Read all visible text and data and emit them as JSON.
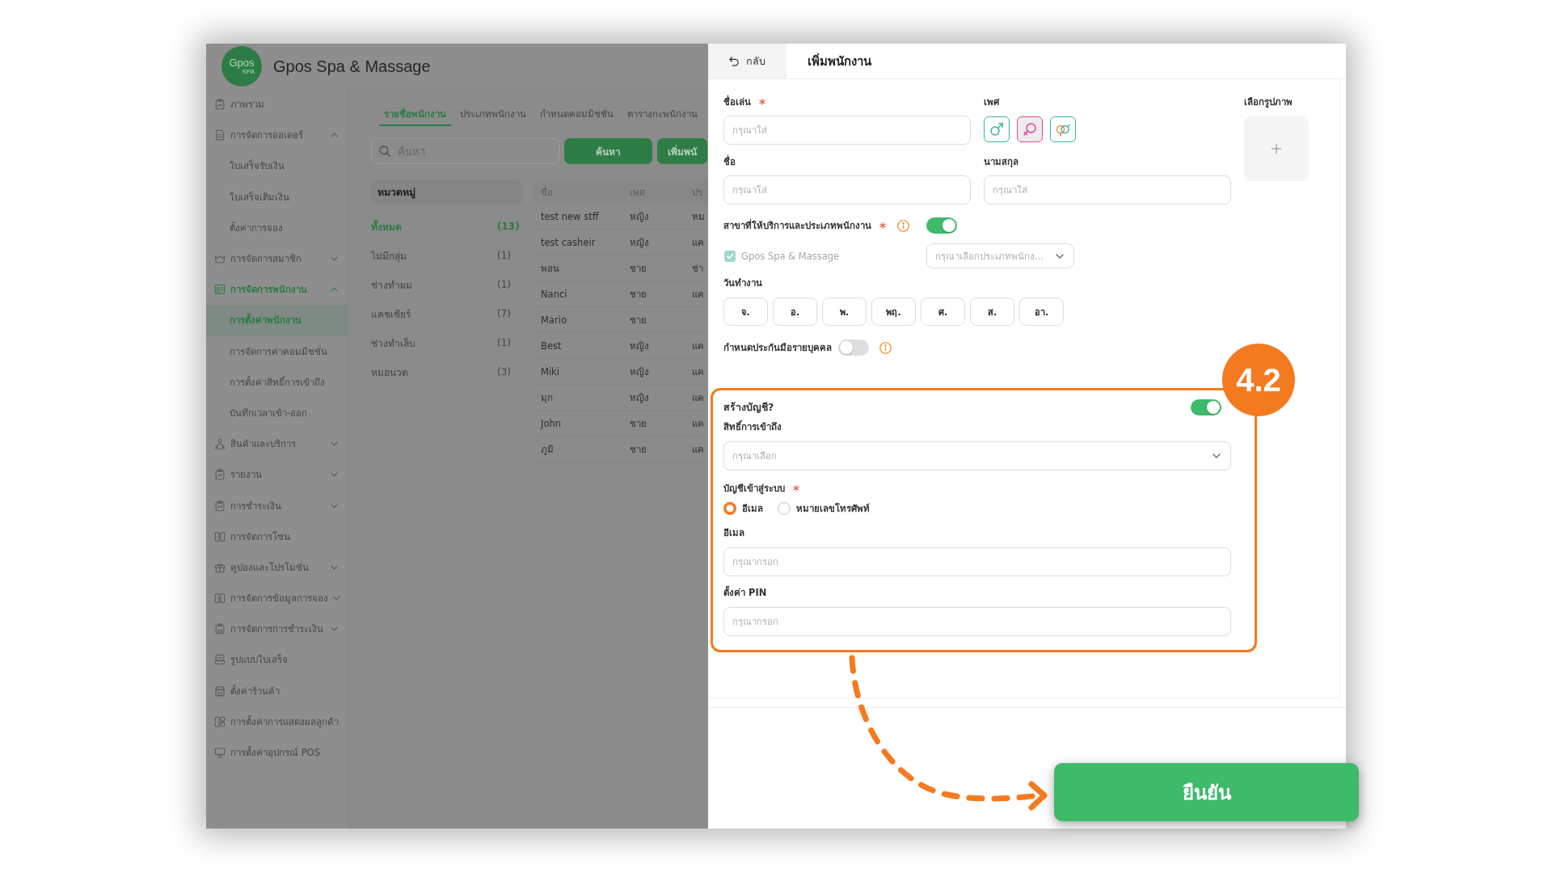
{
  "brand": {
    "logo_text": "Gpos",
    "logo_subtext": "SPA",
    "name": "Gpos Spa & Massage"
  },
  "sidebar": {
    "items": [
      {
        "kind": "link",
        "label": "ภาพรวม",
        "selected": false
      },
      {
        "kind": "group",
        "label": "การจัดการออเดอร์",
        "selected": false,
        "expanded": true,
        "children": [
          {
            "label": "ใบเสร็จรับเงิน",
            "selected": false
          },
          {
            "label": "ใบเสร็จเติมเงิน",
            "selected": false
          },
          {
            "label": "ตั้งค่าการจอง",
            "selected": false
          }
        ]
      },
      {
        "kind": "group",
        "label": "การจัดการสมาชิก",
        "selected": false,
        "expanded": false
      },
      {
        "kind": "group",
        "label": "การจัดการพนักงาน",
        "selected": true,
        "expanded": true,
        "children": [
          {
            "label": "การตั้งค่าพนักงาน",
            "selected": true
          },
          {
            "label": "การจัดการค่าคอมมิชชั่น",
            "selected": false
          },
          {
            "label": "การตั้งค่าสิทธิ์การเข้าถึง",
            "selected": false
          },
          {
            "label": "บันทึกเวลาเข้า-ออก",
            "selected": false
          }
        ]
      },
      {
        "kind": "group",
        "label": "สินค้าและบริการ",
        "selected": false,
        "expanded": false
      },
      {
        "kind": "group",
        "label": "รายงาน",
        "selected": false,
        "expanded": false
      },
      {
        "kind": "group",
        "label": "การชำระเงิน",
        "selected": false,
        "expanded": false
      },
      {
        "kind": "link",
        "label": "การจัดการโซน",
        "selected": false
      },
      {
        "kind": "group",
        "label": "คูปองและโปรโมชั่น",
        "selected": false,
        "expanded": false
      },
      {
        "kind": "group",
        "label": "การจัดการข้อมูลการจอง",
        "selected": false,
        "expanded": false
      },
      {
        "kind": "group",
        "label": "การจัดการการชำระเงิน",
        "selected": false,
        "expanded": false
      },
      {
        "kind": "link",
        "label": "รูปแบบใบเสร็จ",
        "selected": false
      },
      {
        "kind": "link",
        "label": "ตั้งค่าร้านค้า",
        "selected": false
      },
      {
        "kind": "link",
        "label": "การตั้งค่าการแสดงผลลูกค้า",
        "selected": false
      },
      {
        "kind": "link",
        "label": "การตั้งค่าอุปกรณ์ POS",
        "selected": false
      }
    ]
  },
  "tabs": [
    {
      "label": "รายชื่อพนักงาน",
      "selected": true
    },
    {
      "label": "ประเภทพนักงาน",
      "selected": false
    },
    {
      "label": "กำหนดคอมมิชชั่น",
      "selected": false
    },
    {
      "label": "ตารางกะพนักงาน",
      "selected": false
    }
  ],
  "search": {
    "placeholder": "ค้นหา"
  },
  "toolbar_buttons": [
    "ค้นหา",
    "เพิ่มพนั"
  ],
  "categories": {
    "title": "หมวดหมู่",
    "items": [
      {
        "label": "ทั้งหมด",
        "count": "(13)",
        "selected": true
      },
      {
        "label": "ไม่มีกลุ่ม",
        "count": "(1)",
        "selected": false
      },
      {
        "label": "ช่างทำผม",
        "count": "(1)",
        "selected": false
      },
      {
        "label": "แคชเชียร์",
        "count": "(7)",
        "selected": false
      },
      {
        "label": "ช่างทำเล็บ",
        "count": "(1)",
        "selected": false
      },
      {
        "label": "หมอนวด",
        "count": "(3)",
        "selected": false
      }
    ]
  },
  "table": {
    "columns": [
      "ชื่อ",
      "เพศ",
      "ปร"
    ],
    "rows": [
      {
        "name": "test new stff",
        "gender": "หญิง",
        "column_3": "หม"
      },
      {
        "name": "test casheir",
        "gender": "หญิง",
        "column_3": "แค"
      },
      {
        "name": "พอน",
        "gender": "ชาย",
        "column_3": "ช่า"
      },
      {
        "name": "Nanci",
        "gender": "ชาย",
        "column_3": "แค"
      },
      {
        "name": "Mario",
        "gender": "ชาย"
      },
      {
        "name": "Best",
        "gender": "หญิง",
        "column_3": "แค"
      },
      {
        "name": "Miki",
        "gender": "หญิง",
        "column_3": "แค"
      },
      {
        "name": "มุก",
        "gender": "หญิง",
        "column_3": "แค"
      },
      {
        "name": "John",
        "gender": "ชาย",
        "column_3": "แค"
      },
      {
        "name": "ภูมิ",
        "gender": "ชาย",
        "column_3": "แค"
      }
    ]
  },
  "drawer": {
    "back": "กลับ",
    "title": "เพิ่มพนักงาน",
    "nickname": {
      "label": "ชื่อเล่น",
      "required": true,
      "placeholder": "กรุณาใส่"
    },
    "gender": {
      "label": "เพศ",
      "options": [
        {
          "selected": false
        },
        {
          "selected": true
        },
        {
          "selected": false
        }
      ]
    },
    "photo": {
      "label": "เลือกรูปภาพ"
    },
    "first_name": {
      "label": "ชื่อ",
      "placeholder": "กรุณาใส่"
    },
    "last_name": {
      "label": "นามสกุล",
      "placeholder": "กรุณาใส่"
    },
    "branch": {
      "label": "สาขาที่ให้บริการและประเภทพนักงาน",
      "required": true,
      "on": true,
      "option": {
        "label": "Gpos Spa & Massage",
        "checked": true,
        "disabled": true
      },
      "type_select": {
        "placeholder": "กรุณาเลือกประเภทพนักง..."
      }
    },
    "work_days": {
      "label": "วันทำงาน",
      "days": [
        {
          "label": "จ.",
          "selected": false
        },
        {
          "label": "อ.",
          "selected": false
        },
        {
          "label": "พ.",
          "selected": false
        },
        {
          "label": "พฤ.",
          "selected": false
        },
        {
          "label": "ศ.",
          "selected": false
        },
        {
          "label": "ส.",
          "selected": false
        },
        {
          "label": "อา.",
          "selected": false
        }
      ]
    },
    "insurance": {
      "label": "กำหนดประกันมือรายบุคคล",
      "on": false
    },
    "account": {
      "label": "สร้างบัญชี?",
      "on": true,
      "access": {
        "label": "สิทธิ์การเข้าถึง",
        "placeholder": "กรุณาเลือก"
      },
      "login": {
        "label": "บัญชีเข้าสู่ระบบ",
        "required": true,
        "options": [
          {
            "label": "อีเมล",
            "selected": true
          },
          {
            "label": "หมายเลขโทรศัพท์",
            "selected": false
          }
        ]
      },
      "email": {
        "label": "อีเมล",
        "placeholder": "กรุณากรอก"
      },
      "pin": {
        "label": "ตั้งค่า PIN",
        "placeholder": "กรุณากรอก"
      }
    },
    "confirm": "ยืนยัน"
  },
  "annotation": {
    "step": "4.2"
  }
}
